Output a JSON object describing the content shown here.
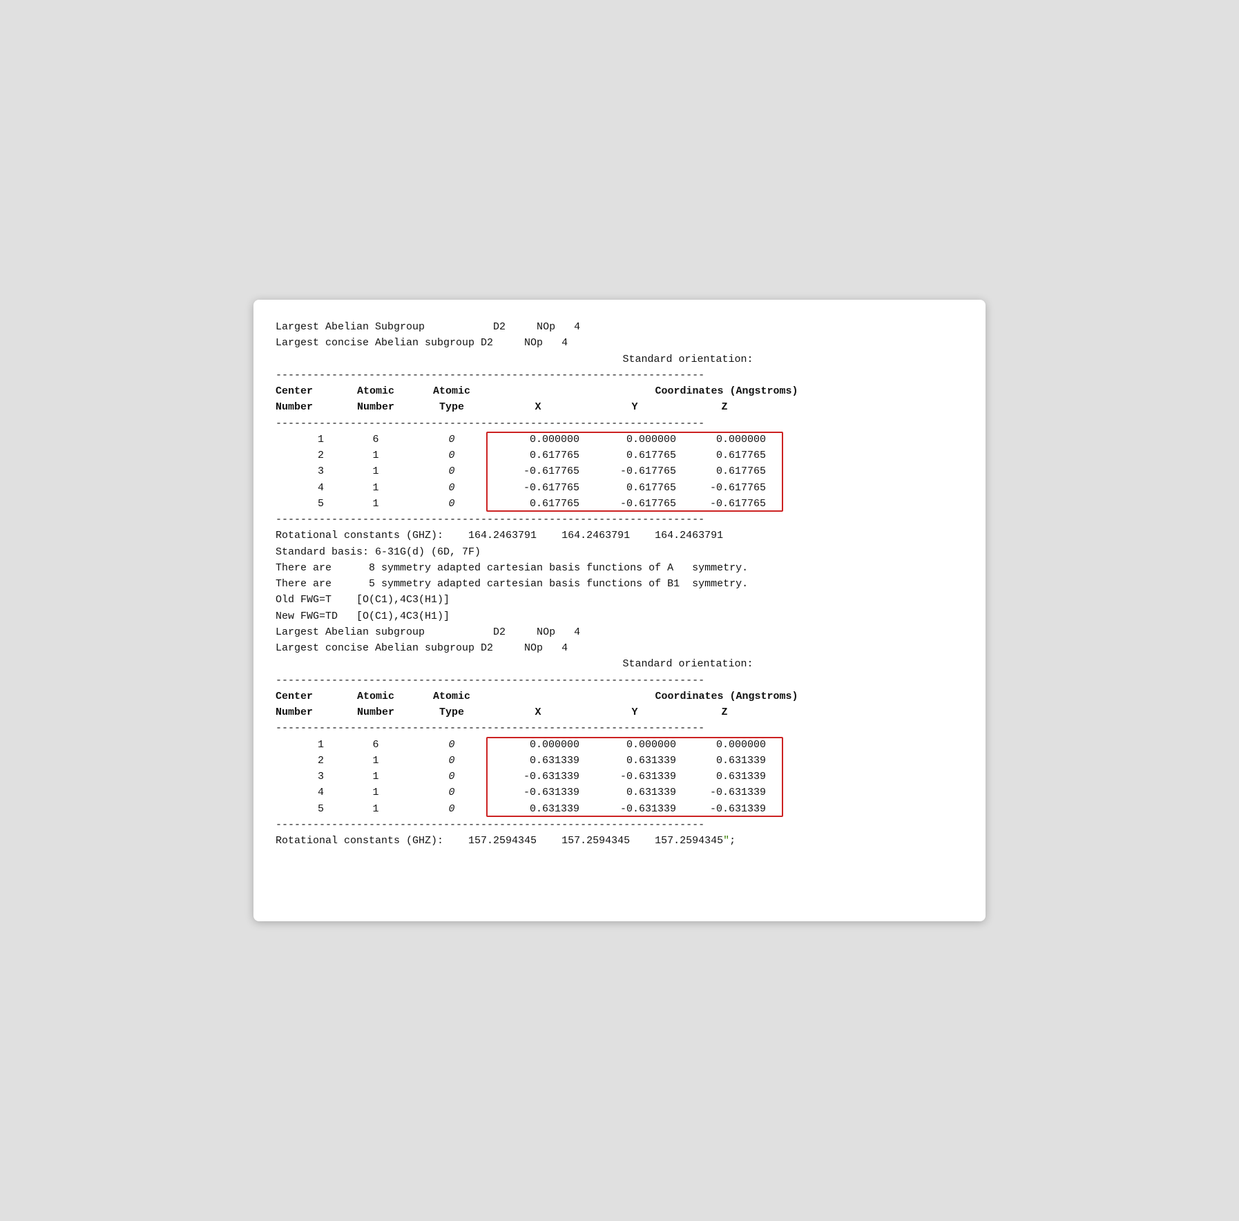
{
  "window": {
    "lines_top": [
      "Largest Abelian Subgroup           D2     NOp   4",
      "Largest concise Abelian subgroup D2     NOp   4",
      "                      Standard orientation:"
    ],
    "separator": "---------------------------------------------------------------------",
    "table1": {
      "header1": "Center          Atomic          Atomic              Coordinates (Angstroms)",
      "header2": "Number          Number            Type                  X           Y           Z",
      "rows": [
        {
          "center": "1",
          "atomic_num": "6",
          "atomic_type": "0",
          "x": "0.000000",
          "y": "0.000000",
          "z": "0.000000"
        },
        {
          "center": "2",
          "atomic_num": "1",
          "atomic_type": "0",
          "x": "0.617765",
          "y": "0.617765",
          "z": "0.617765"
        },
        {
          "center": "3",
          "atomic_num": "1",
          "atomic_type": "0",
          "x": "-0.617765",
          "y": "-0.617765",
          "z": "0.617765"
        },
        {
          "center": "4",
          "atomic_num": "1",
          "atomic_type": "0",
          "x": "-0.617765",
          "y": "0.617765",
          "z": "-0.617765"
        },
        {
          "center": "5",
          "atomic_num": "1",
          "atomic_type": "0",
          "x": "0.617765",
          "y": "-0.617765",
          "z": "-0.617765"
        }
      ]
    },
    "lines_middle": [
      "Rotational constants (GHZ):    164.2463791    164.2463791    164.2463791",
      "Standard basis: 6-31G(d) (6D, 7F)",
      "There are      8 symmetry adapted cartesian basis functions of A   symmetry.",
      "There are      5 symmetry adapted cartesian basis functions of B1  symmetry.",
      "Old FWG=T    [O(C1),4C3(H1)]",
      "New FWG=TD   [O(C1),4C3(H1)]",
      "Largest Abelian subgroup           D2     NOp   4",
      "Largest concise Abelian subgroup D2     NOp   4",
      "                      Standard orientation:"
    ],
    "table2": {
      "header1": "Center          Atomic          Atomic              Coordinates (Angstroms)",
      "header2": "Number          Number            Type                  X           Y           Z",
      "rows": [
        {
          "center": "1",
          "atomic_num": "6",
          "atomic_type": "0",
          "x": "0.000000",
          "y": "0.000000",
          "z": "0.000000"
        },
        {
          "center": "2",
          "atomic_num": "1",
          "atomic_type": "0",
          "x": "0.631339",
          "y": "0.631339",
          "z": "0.631339"
        },
        {
          "center": "3",
          "atomic_num": "1",
          "atomic_type": "0",
          "x": "-0.631339",
          "y": "-0.631339",
          "z": "0.631339"
        },
        {
          "center": "4",
          "atomic_num": "1",
          "atomic_type": "0",
          "x": "-0.631339",
          "y": "0.631339",
          "z": "-0.631339"
        },
        {
          "center": "5",
          "atomic_num": "1",
          "atomic_type": "0",
          "x": "0.631339",
          "y": "-0.631339",
          "z": "-0.631339"
        }
      ]
    },
    "line_bottom": "Rotational constants (GHZ):    157.2594345    157.2594345    157.2594345"
  }
}
